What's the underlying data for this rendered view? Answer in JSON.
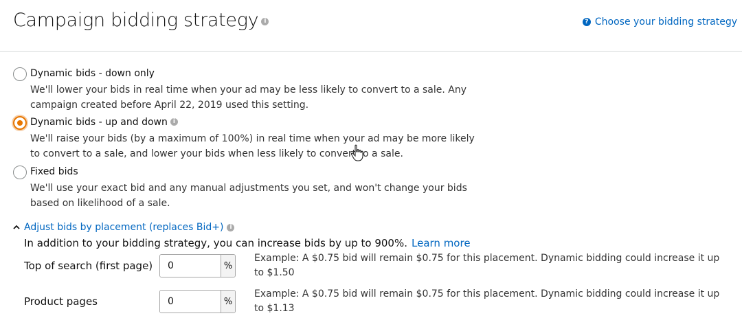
{
  "header": {
    "title": "Campaign bidding strategy",
    "help_link": "Choose your bidding strategy"
  },
  "strategies": [
    {
      "label": "Dynamic bids - down only",
      "description": "We'll lower your bids in real time when your ad may be less likely to convert to a sale. Any campaign created before April 22, 2019 used this setting.",
      "selected": false
    },
    {
      "label": "Dynamic bids - up and down",
      "description": "We'll raise your bids (by a maximum of 100%) in real time when your ad may be more likely to convert to a sale, and lower your bids when less likely to convert to a sale.",
      "selected": true
    },
    {
      "label": "Fixed bids",
      "description": "We'll use your exact bid and any manual adjustments you set, and won't change your bids based on likelihood of a sale.",
      "selected": false
    }
  ],
  "adjust": {
    "toggle_label": "Adjust bids by placement (replaces Bid+)",
    "intro": "In addition to your bidding strategy, you can increase bids by up to 900%.",
    "learn_more": "Learn more",
    "placements": [
      {
        "label": "Top of search (first page)",
        "value": "0",
        "suffix": "%",
        "example": "Example: A $0.75 bid will remain $0.75 for this placement. Dynamic bidding could increase it up to $1.50"
      },
      {
        "label": "Product pages",
        "value": "0",
        "suffix": "%",
        "example": "Example: A $0.75 bid will remain $0.75 for this placement. Dynamic bidding could increase it up to $1.13"
      }
    ]
  },
  "colors": {
    "link": "#0066c0",
    "accent": "#e77600",
    "divider": "#d5d9d9"
  }
}
